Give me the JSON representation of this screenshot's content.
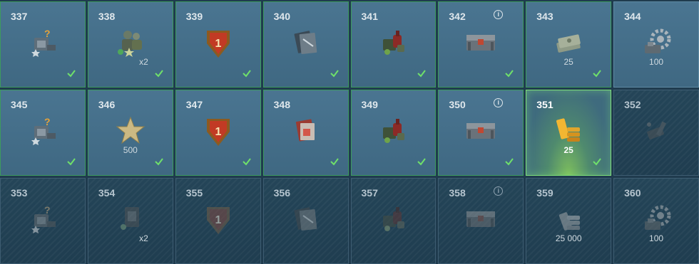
{
  "cells": [
    {
      "num": "337",
      "icon": "crew-book-icon",
      "check": true
    },
    {
      "num": "338",
      "icon": "crew-members-icon",
      "mult": "x2",
      "check": true
    },
    {
      "num": "339",
      "icon": "medal-badge-icon",
      "check": true
    },
    {
      "num": "340",
      "icon": "documents-icon",
      "check": true
    },
    {
      "num": "341",
      "icon": "supplies-icon",
      "check": true
    },
    {
      "num": "342",
      "icon": "loot-crate-icon",
      "info": true,
      "check": true
    },
    {
      "num": "343",
      "icon": "credits-stack-icon",
      "qty": "25",
      "check": true
    },
    {
      "num": "344",
      "icon": "gear-machine-icon",
      "qty": "100",
      "check": false
    },
    {
      "num": "345",
      "icon": "crew-book-icon",
      "check": true
    },
    {
      "num": "346",
      "icon": "star-icon",
      "qty": "500",
      "check": true
    },
    {
      "num": "347",
      "icon": "medal-badge-icon",
      "check": true
    },
    {
      "num": "348",
      "icon": "red-documents-icon",
      "check": true
    },
    {
      "num": "349",
      "icon": "supplies-icon",
      "check": true
    },
    {
      "num": "350",
      "icon": "loot-crate-icon",
      "info": true,
      "check": true
    },
    {
      "num": "351",
      "icon": "gold-bars-icon",
      "qty": "25",
      "check": true,
      "current": true
    },
    {
      "num": "352",
      "icon": "camo-tool-icon",
      "locked": true
    },
    {
      "num": "353",
      "icon": "crew-book-icon",
      "locked": true
    },
    {
      "num": "354",
      "icon": "crew-card-icon",
      "mult": "x2",
      "locked": true
    },
    {
      "num": "355",
      "icon": "medal-badge-icon",
      "locked": true
    },
    {
      "num": "356",
      "icon": "documents-icon",
      "locked": true
    },
    {
      "num": "357",
      "icon": "supplies-icon",
      "locked": true
    },
    {
      "num": "358",
      "icon": "loot-crate-icon",
      "info": true,
      "locked": true
    },
    {
      "num": "359",
      "icon": "silver-stack-icon",
      "qty": "25 000",
      "locked": true
    },
    {
      "num": "360",
      "icon": "gear-machine-icon",
      "qty": "100",
      "locked": true
    }
  ],
  "info_glyph": "i",
  "colors": {
    "check": "#6fe06a",
    "panel": "#4a7591",
    "locked": "#244558",
    "gold": "#f2b632",
    "medal": "#c23a24"
  }
}
